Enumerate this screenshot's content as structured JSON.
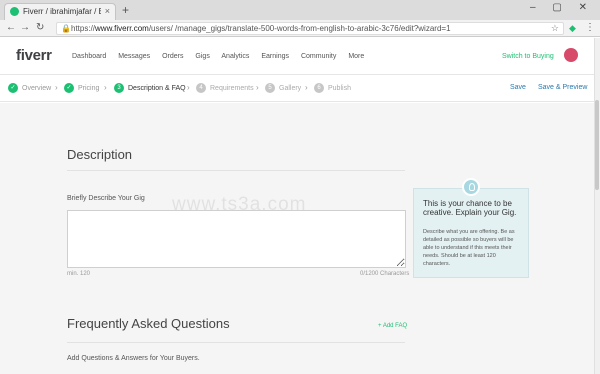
{
  "browser": {
    "tab_title": "Fiverr / ibrahimjafar / Edit",
    "tab_close": "×",
    "new_tab": "+",
    "window_controls": "– ▢ ✕",
    "url_prefix": "https://",
    "url_host": "www.fiverr.com",
    "url_path": "/users/                    /manage_gigs/translate-500-words-from-english-to-arabic-3c76/edit?wizard=1",
    "back": "←",
    "forward": "→",
    "reload": "↻",
    "lock": "🔒",
    "star": "☆",
    "menu": "⋮"
  },
  "header": {
    "logo": "fiverr",
    "nav": [
      "Dashboard",
      "Messages",
      "Orders",
      "Gigs",
      "Analytics",
      "Earnings",
      "Community",
      "More"
    ],
    "switch_label": "Switch to Buying"
  },
  "wizard": {
    "steps": [
      {
        "label": "Overview",
        "state": "done",
        "num": "✓"
      },
      {
        "label": "Pricing",
        "state": "done",
        "num": "✓"
      },
      {
        "label": "Description & FAQ",
        "state": "active",
        "num": "3"
      },
      {
        "label": "Requirements",
        "state": "todo",
        "num": "4"
      },
      {
        "label": "Gallery",
        "state": "todo",
        "num": "5"
      },
      {
        "label": "Publish",
        "state": "todo",
        "num": "6"
      }
    ],
    "save_label": "Save",
    "save_preview_label": "Save & Preview"
  },
  "description": {
    "title": "Description",
    "field_label": "Briefly Describe Your Gig",
    "textarea_value": "",
    "min_text": "min. 120",
    "counter": "0/1200 Characters",
    "watermark": "www.ts3a.com"
  },
  "tip": {
    "title": "This is your chance to be creative. Explain your Gig.",
    "body": "Describe what you are offering. Be as detailed as possible so buyers will be able to understand if this meets their needs. Should be at least 120 characters."
  },
  "faq": {
    "title": "Frequently Asked Questions",
    "add_label": "+ Add FAQ",
    "subtitle": "Add Questions & Answers for Your Buyers."
  },
  "colors": {
    "brand": "#1dbf73",
    "link": "#2a7ab0",
    "tip_bg": "#e4f1f3"
  }
}
